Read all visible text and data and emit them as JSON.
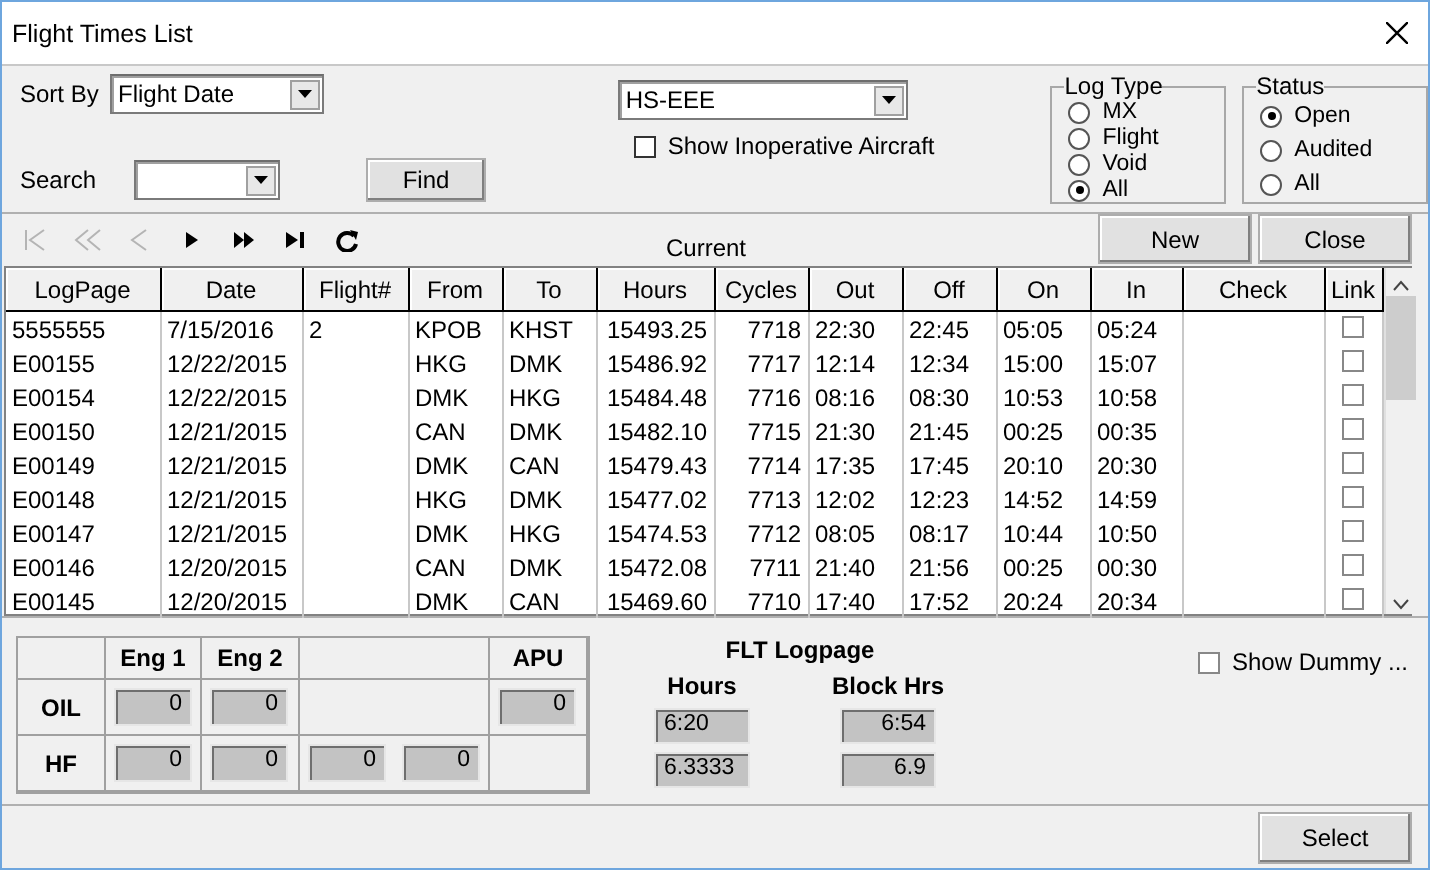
{
  "window": {
    "title": "Flight Times List"
  },
  "sort_by": {
    "label": "Sort By",
    "value": "Flight Date"
  },
  "search": {
    "label": "Search",
    "find_button": "Find"
  },
  "aircraft": {
    "value": "HS-EEE",
    "show_inoperative": {
      "label": "Show Inoperative Aircraft",
      "checked": false
    }
  },
  "log_type": {
    "title": "Log Type",
    "options": [
      {
        "label": "MX",
        "selected": false
      },
      {
        "label": "Flight",
        "selected": false
      },
      {
        "label": "Void",
        "selected": false
      },
      {
        "label": "All",
        "selected": true
      }
    ]
  },
  "status": {
    "title": "Status",
    "options": [
      {
        "label": "Open",
        "selected": true
      },
      {
        "label": "Audited",
        "selected": false
      },
      {
        "label": "All",
        "selected": false
      }
    ]
  },
  "toolbar": {
    "nav_buttons": [
      {
        "kind": "first",
        "disabled": true
      },
      {
        "kind": "rewind",
        "disabled": true
      },
      {
        "kind": "previous",
        "disabled": true
      },
      {
        "kind": "next",
        "disabled": false
      },
      {
        "kind": "fast_forward",
        "disabled": false
      },
      {
        "kind": "last",
        "disabled": false
      },
      {
        "kind": "refresh",
        "disabled": false
      }
    ],
    "position_label": "Current",
    "buttons": [
      "New",
      "Close"
    ]
  },
  "table": {
    "columns": [
      "LogPage",
      "Date",
      "Flight#",
      "From",
      "To",
      "Hours",
      "Cycles",
      "Out",
      "Off",
      "On",
      "In",
      "Check",
      "Link"
    ],
    "rows": [
      {
        "logpage": "5555555",
        "date": "7/15/2016",
        "flight_no": "2",
        "from": "KPOB",
        "to": "KHST",
        "hours": "15493.25",
        "cycles": "7718",
        "out": "22:30",
        "off": "22:45",
        "on": "05:05",
        "in": "05:24",
        "link": false
      },
      {
        "logpage": "E00155",
        "date": "12/22/2015",
        "from": "HKG",
        "to": "DMK",
        "hours": "15486.92",
        "cycles": "7717",
        "out": "12:14",
        "off": "12:34",
        "on": "15:00",
        "in": "15:07",
        "link": false
      },
      {
        "logpage": "E00154",
        "date": "12/22/2015",
        "from": "DMK",
        "to": "HKG",
        "hours": "15484.48",
        "cycles": "7716",
        "out": "08:16",
        "off": "08:30",
        "on": "10:53",
        "in": "10:58",
        "link": false
      },
      {
        "logpage": "E00150",
        "date": "12/21/2015",
        "from": "CAN",
        "to": "DMK",
        "hours": "15482.10",
        "cycles": "7715",
        "out": "21:30",
        "off": "21:45",
        "on": "00:25",
        "in": "00:35",
        "link": false
      },
      {
        "logpage": "E00149",
        "date": "12/21/2015",
        "from": "DMK",
        "to": "CAN",
        "hours": "15479.43",
        "cycles": "7714",
        "out": "17:35",
        "off": "17:45",
        "on": "20:10",
        "in": "20:30",
        "link": false
      },
      {
        "logpage": "E00148",
        "date": "12/21/2015",
        "from": "HKG",
        "to": "DMK",
        "hours": "15477.02",
        "cycles": "7713",
        "out": "12:02",
        "off": "12:23",
        "on": "14:52",
        "in": "14:59",
        "link": false
      },
      {
        "logpage": "E00147",
        "date": "12/21/2015",
        "from": "DMK",
        "to": "HKG",
        "hours": "15474.53",
        "cycles": "7712",
        "out": "08:05",
        "off": "08:17",
        "on": "10:44",
        "in": "10:50",
        "link": false
      },
      {
        "logpage": "E00146",
        "date": "12/20/2015",
        "from": "CAN",
        "to": "DMK",
        "hours": "15472.08",
        "cycles": "7711",
        "out": "21:40",
        "off": "21:56",
        "on": "00:25",
        "in": "00:30",
        "link": false
      },
      {
        "logpage": "E00145",
        "date": "12/20/2015",
        "from": "DMK",
        "to": "CAN",
        "hours": "15469.60",
        "cycles": "7710",
        "out": "17:40",
        "off": "17:52",
        "on": "20:24",
        "in": "20:34",
        "link": false
      }
    ]
  },
  "fluids": {
    "headers": {
      "eng_1": "Eng 1",
      "eng_2": "Eng 2",
      "apu": "APU"
    },
    "rows": [
      {
        "label": "OIL",
        "eng_1": "0",
        "eng_2": "0",
        "apu": "0"
      },
      {
        "label": "HF",
        "eng_1": "0",
        "eng_2": "0",
        "column_3": "0",
        "column_4": "0"
      }
    ]
  },
  "flt_logpage": {
    "title": "FLT Logpage",
    "hours_label": "Hours",
    "block_label": "Block Hrs",
    "hours": [
      "6:20",
      "6.3333"
    ],
    "block_hrs": [
      "6:54",
      "6.9"
    ]
  },
  "show_dummy": {
    "label": "Show Dummy ...",
    "checked": false
  },
  "select_button": "Select"
}
